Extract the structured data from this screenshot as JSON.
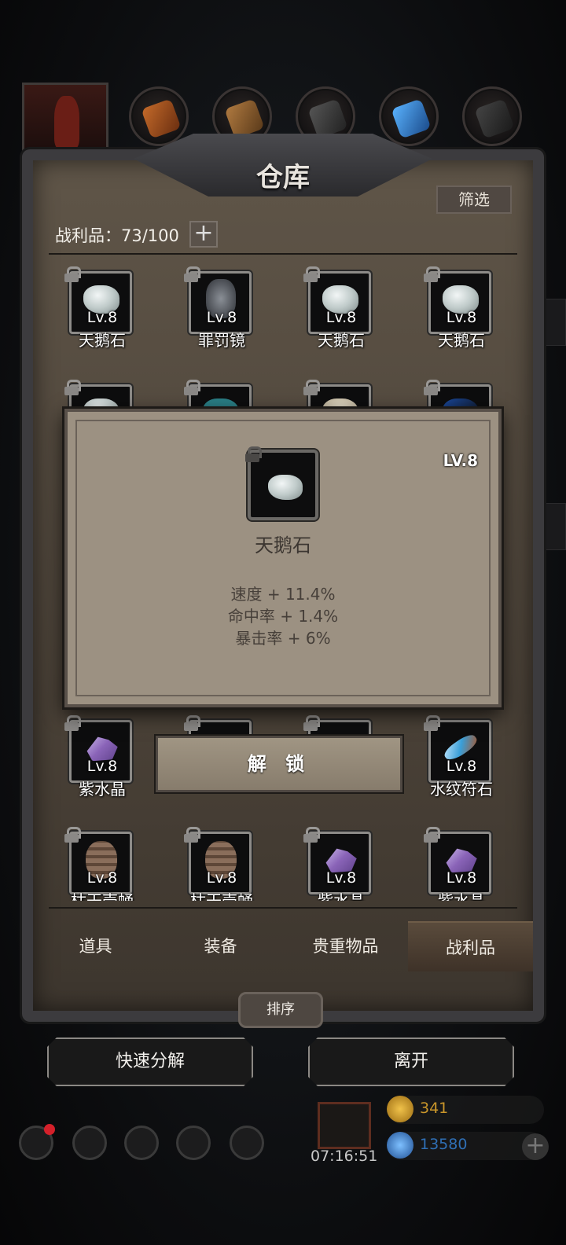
{
  "window": {
    "title": "仓库",
    "filter_label": "筛选"
  },
  "loot": {
    "label": "战利品：73/100",
    "add_symbol": "+"
  },
  "category_tabs": [
    "relic",
    "leather",
    "wood",
    "ore",
    "crystal",
    "metal"
  ],
  "grid": {
    "rows": [
      [
        {
          "level": "Lv.8",
          "name": "天鹅石",
          "art": "stone"
        },
        {
          "level": "Lv.8",
          "name": "罪罚镜",
          "art": "mirror"
        },
        {
          "level": "Lv.8",
          "name": "天鹅石",
          "art": "stone"
        },
        {
          "level": "Lv.8",
          "name": "天鹅石",
          "art": "stone"
        }
      ],
      [
        {
          "level": "Lv.8",
          "name": "紫水晶",
          "art": "amethyst"
        },
        {
          "level": "",
          "name": "",
          "art": "hidden"
        },
        {
          "level": "",
          "name": "",
          "art": "hidden"
        },
        {
          "level": "Lv.8",
          "name": "水纹符石",
          "art": "rune"
        }
      ],
      [
        {
          "level": "Lv.8",
          "name": "枯干壳蛹",
          "art": "shell"
        },
        {
          "level": "Lv.8",
          "name": "枯干壳蛹",
          "art": "shell"
        },
        {
          "level": "Lv.8",
          "name": "紫水晶",
          "art": "amethyst"
        },
        {
          "level": "Lv.8",
          "name": "紫水晶",
          "art": "amethyst"
        }
      ]
    ]
  },
  "popup": {
    "level": "LV.8",
    "name": "天鹅石",
    "stats": [
      "速度 + 11.4%",
      "命中率 + 1.4%",
      "暴击率 + 6%"
    ]
  },
  "unlock_button": "解 锁",
  "inventory_tabs": [
    {
      "label": "道具",
      "active": false
    },
    {
      "label": "装备",
      "active": false
    },
    {
      "label": "贵重物品",
      "active": false
    },
    {
      "label": "战利品",
      "active": true
    }
  ],
  "sort_button": "排序",
  "actions": {
    "quick_decompose": "快速分解",
    "leave": "离开"
  },
  "footer": {
    "clock": "07:16:51",
    "gold": "341",
    "gems": "13580",
    "icons": [
      "settings-icon",
      "star-icon",
      "map-icon",
      "mail-icon",
      "shield-icon"
    ]
  },
  "colors": {
    "frame": "#4b4238",
    "popup_bg": "#9c9182",
    "gold": "#c9962a",
    "gem": "#2f6fb5"
  }
}
